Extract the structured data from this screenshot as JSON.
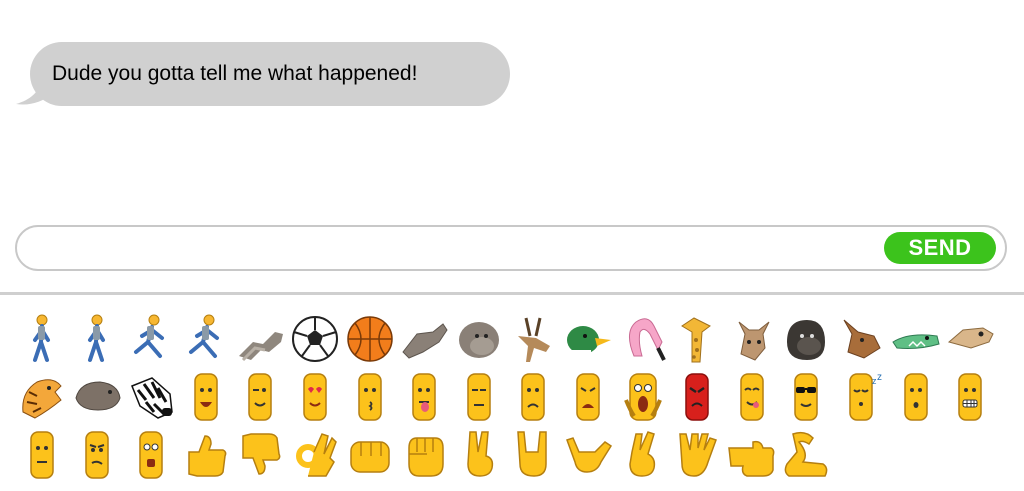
{
  "chat": {
    "incoming_message": "Dude you gotta tell me what happened!"
  },
  "composer": {
    "input_value": "",
    "send_label": "SEND"
  },
  "colors": {
    "bubble": "#d0d0d0",
    "send": "#3cc31c",
    "emoji_yellow": "#fcc21b",
    "emoji_outline": "#c7921b"
  },
  "emoji_tray": {
    "row1": [
      "person-walking-icon",
      "person-walking-icon",
      "person-running-icon",
      "person-running-icon",
      "footprints-icon",
      "soccer-ball-icon",
      "basketball-icon",
      "fist-bump-icon",
      "monkey-icon",
      "antelope-icon",
      "duck-icon",
      "flamingo-icon",
      "giraffe-icon",
      "donkey-icon",
      "gorilla-icon",
      "kangaroo-icon",
      "crocodile-icon",
      "meerkat-icon"
    ],
    "row2": [
      "tiger-icon",
      "hippo-icon",
      "zebra-icon",
      "grinning-face-icon",
      "winking-face-icon",
      "heart-eyes-face-icon",
      "kissing-face-icon",
      "tongue-face-icon",
      "unamused-face-icon",
      "worried-face-icon",
      "weary-face-icon",
      "screaming-face-icon",
      "angry-face-icon",
      "yum-face-icon",
      "sunglasses-face-icon",
      "sleeping-face-icon",
      "surprised-face-icon",
      "grimacing-face-icon"
    ],
    "row3": [
      "neutral-face-icon",
      "skeptical-face-icon",
      "shocked-face-icon",
      "thumbs-up-icon",
      "thumbs-down-icon",
      "ok-hand-icon",
      "fist-icon",
      "raised-fist-icon",
      "victory-hand-icon",
      "rock-hand-icon",
      "call-me-hand-icon",
      "crossed-fingers-icon",
      "vulcan-salute-icon",
      "pointing-hand-icon",
      "flexed-arm-icon"
    ]
  }
}
